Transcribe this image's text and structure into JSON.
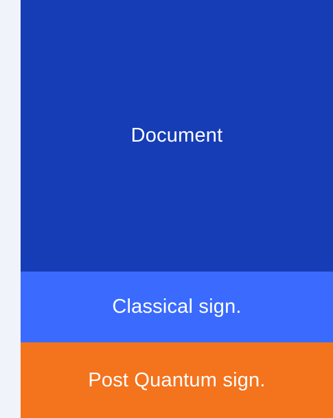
{
  "blocks": [
    {
      "id": "document",
      "label": "Document",
      "color": "#163db6"
    },
    {
      "id": "classical",
      "label": "Classical sign.",
      "color": "#3a6bfe"
    },
    {
      "id": "pq",
      "label": "Post Quantum sign.",
      "color": "#f4731d"
    }
  ],
  "background_color": "#f1f3fb"
}
